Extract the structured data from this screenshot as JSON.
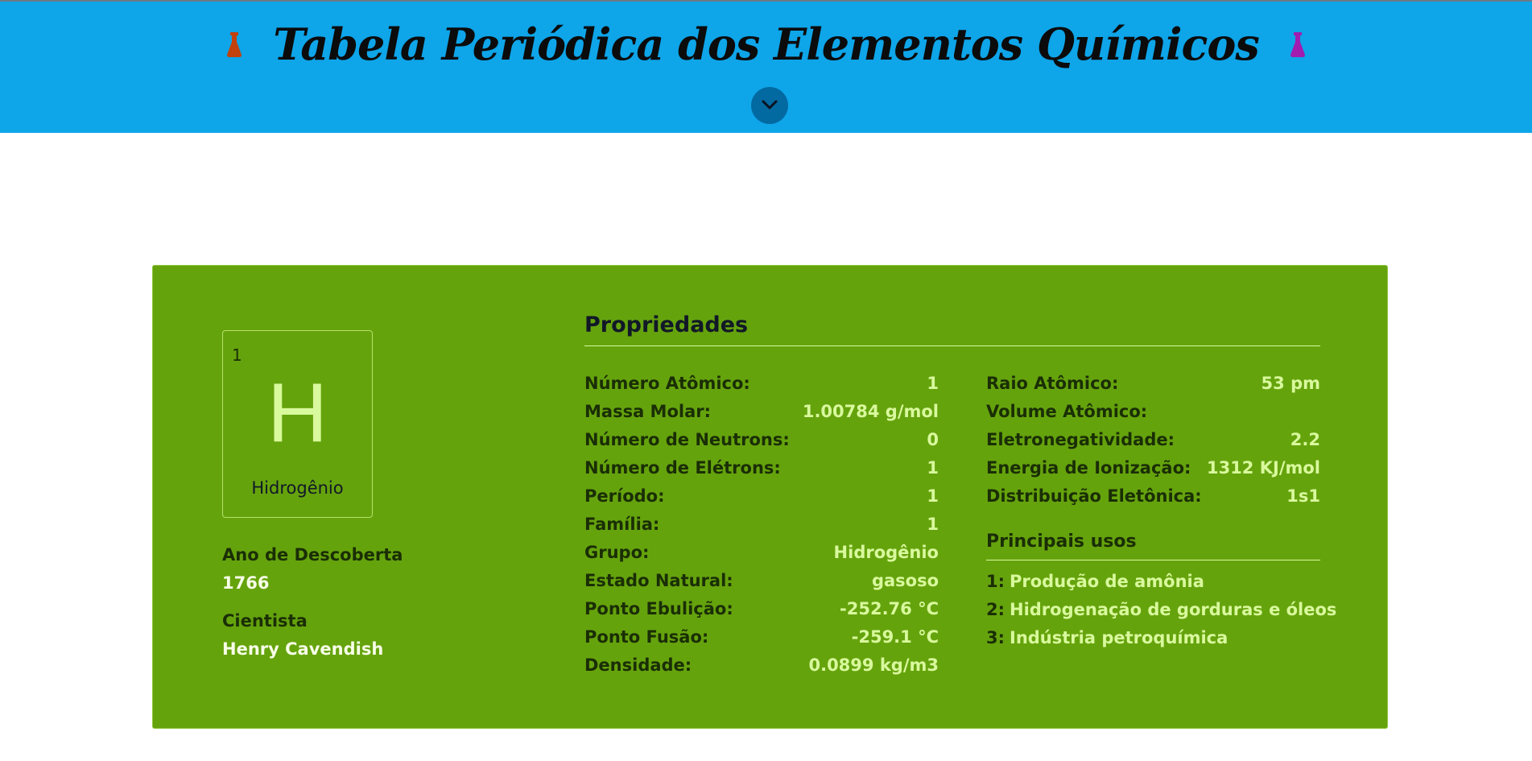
{
  "header": {
    "title": "Tabela Periódica dos Elementos Químicos",
    "left_icon": "flask-icon",
    "left_icon_color": "#c2410c",
    "right_icon": "flask-icon",
    "right_icon_color": "#a21caf",
    "expand_icon": "chevron-down-icon",
    "background": "#0ea5e9"
  },
  "element": {
    "number": "1",
    "symbol": "H",
    "name": "Hidrogênio",
    "card_color": "#65a30d",
    "discovery_label": "Ano de Descoberta",
    "discovery_year": "1766",
    "scientist_label": "Cientista",
    "scientist": "Henry Cavendish"
  },
  "properties": {
    "title": "Propriedades",
    "left": [
      {
        "label": "Número Atômico:",
        "value": "1"
      },
      {
        "label": "Massa Molar:",
        "value": "1.00784 g/mol"
      },
      {
        "label": "Número de Neutrons:",
        "value": "0"
      },
      {
        "label": "Número de Elétrons:",
        "value": "1"
      },
      {
        "label": "Período:",
        "value": "1"
      },
      {
        "label": "Família:",
        "value": "1"
      },
      {
        "label": "Grupo:",
        "value": "Hidrogênio"
      },
      {
        "label": "Estado Natural:",
        "value": "gasoso"
      },
      {
        "label": "Ponto Ebulição:",
        "value": "-252.76 °C"
      },
      {
        "label": "Ponto Fusão:",
        "value": "-259.1 °C"
      },
      {
        "label": "Densidade:",
        "value": "0.0899 kg/m3"
      }
    ],
    "right": [
      {
        "label": "Raio Atômico:",
        "value": "53 pm"
      },
      {
        "label": "Volume Atômico:",
        "value": ""
      },
      {
        "label": "Eletronegatividade:",
        "value": "2.2"
      },
      {
        "label": "Energia de Ionização:",
        "value": "1312 KJ/mol"
      },
      {
        "label": "Distribuição Eletônica:",
        "value": "1s1"
      }
    ]
  },
  "usos": {
    "title": "Principais usos",
    "items": [
      {
        "num": "1:",
        "text": "Produção de amônia"
      },
      {
        "num": "2:",
        "text": "Hidrogenação de gorduras e óleos"
      },
      {
        "num": "3:",
        "text": "Indústria petroquímica"
      }
    ]
  }
}
